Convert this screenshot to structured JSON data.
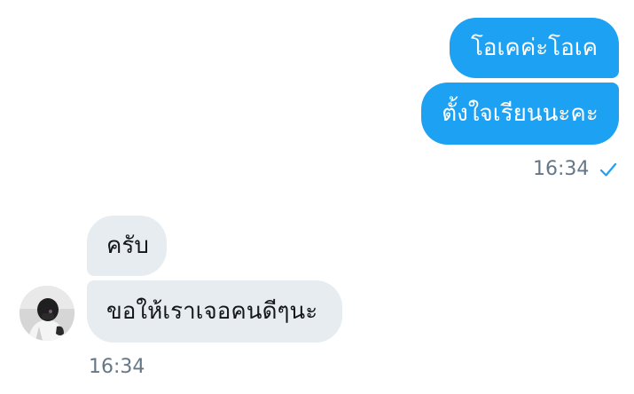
{
  "conversation": {
    "outgoing": [
      {
        "text": "โอเคค่ะโอเค"
      },
      {
        "text": "ตั้งใจเรียนนะคะ"
      }
    ],
    "outgoing_time": "16:34",
    "outgoing_status_icon": "check-icon",
    "incoming": [
      {
        "text": "ครับ"
      },
      {
        "text": "ขอให้เราเจอคนดีๆนะ"
      }
    ],
    "incoming_time": "16:34"
  },
  "colors": {
    "outgoing_bubble": "#1da1f2",
    "incoming_bubble": "#e6ecf0",
    "timestamp": "#657786",
    "read_check": "#1da1f2"
  }
}
